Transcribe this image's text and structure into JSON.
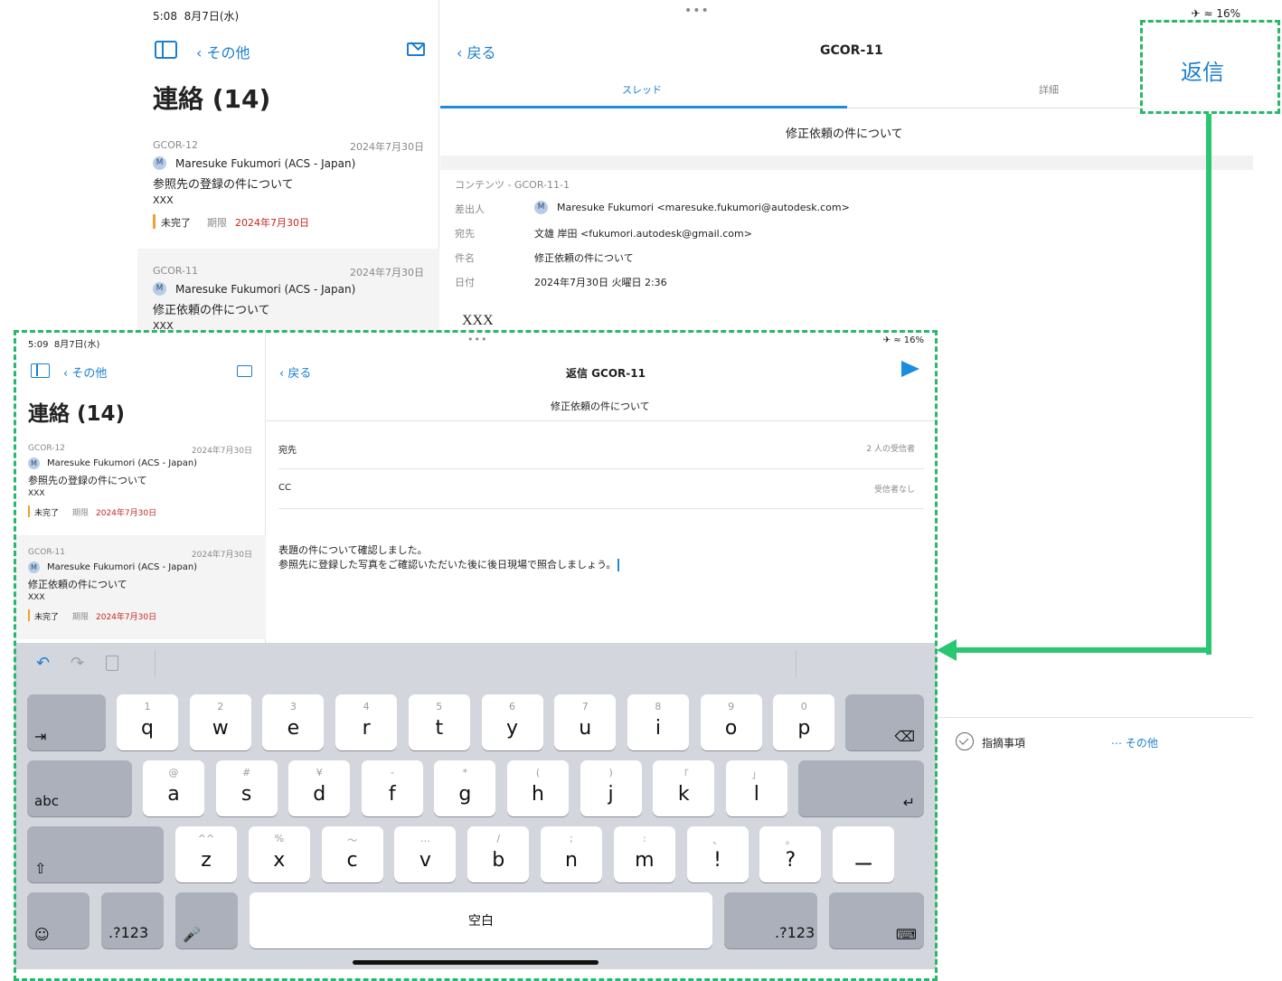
{
  "back": {
    "status_time": "5:08",
    "status_date": "8月7日(水)",
    "status_battery": "16%",
    "nav_back_label": "その他",
    "list_title": "連絡 (14)",
    "items": [
      {
        "id": "GCOR-12",
        "date": "2024年7月30日",
        "avatar": "M",
        "author": "Maresuke Fukumori (ACS - Japan)",
        "subject": "参照先の登録の件について",
        "body": "XXX",
        "status": "未完了",
        "due_label": "期限",
        "due": "2024年7月30日"
      },
      {
        "id": "GCOR-11",
        "date": "2024年7月30日",
        "avatar": "M",
        "author": "Maresuke Fukumori (ACS - Japan)",
        "subject": "修正依頼の件について",
        "body": "XXX"
      }
    ],
    "detail_back": "戻る",
    "detail_title": "GCOR-11",
    "tab_thread": "スレッド",
    "tab_detail": "詳細",
    "reply_label": "返信",
    "thread_subject": "修正依頼の件について",
    "content_label": "コンテンツ - GCOR-11-1",
    "fields": [
      {
        "label": "差出人",
        "value": "Maresuke Fukumori <maresuke.fukumori@autodesk.com>",
        "avatar": "M"
      },
      {
        "label": "宛先",
        "value": "文雄 岸田 <fukumori.autodesk@gmail.com>"
      },
      {
        "label": "件名",
        "value": "修正依頼の件について"
      },
      {
        "label": "日付",
        "value": "2024年7月30日 火曜日 2:36"
      }
    ],
    "body_text": "XXX",
    "bottom_issue": "指摘事項",
    "bottom_more": "その他"
  },
  "front": {
    "status_time": "5:09",
    "status_date": "8月7日(水)",
    "status_battery": "16%",
    "nav_back_label": "その他",
    "list_title": "連絡 (14)",
    "items": [
      {
        "id": "GCOR-12",
        "date": "2024年7月30日",
        "avatar": "M",
        "author": "Maresuke Fukumori (ACS - Japan)",
        "subject": "参照先の登録の件について",
        "body": "XXX",
        "status": "未完了",
        "due_label": "期限",
        "due": "2024年7月30日"
      },
      {
        "id": "GCOR-11",
        "date": "2024年7月30日",
        "avatar": "M",
        "author": "Maresuke Fukumori (ACS - Japan)",
        "subject": "修正依頼の件について",
        "body": "XXX",
        "status": "未完了",
        "due_label": "期限",
        "due": "2024年7月30日"
      }
    ],
    "compose_back": "戻る",
    "compose_title": "返信 GCOR-11",
    "compose_subject": "修正依頼の件について",
    "to_label": "宛先",
    "to_value": "2 人の受信者",
    "cc_label": "CC",
    "cc_value": "受信者なし",
    "message_line1": "表題の件について確認しました。",
    "message_line2": "参照先に登録した写真をご確認いただいた後に後日現場で照合しましょう。"
  },
  "keyboard": {
    "row1": [
      {
        "k": "q",
        "s": "1"
      },
      {
        "k": "w",
        "s": "2"
      },
      {
        "k": "e",
        "s": "3"
      },
      {
        "k": "r",
        "s": "4"
      },
      {
        "k": "t",
        "s": "5"
      },
      {
        "k": "y",
        "s": "6"
      },
      {
        "k": "u",
        "s": "7"
      },
      {
        "k": "i",
        "s": "8"
      },
      {
        "k": "o",
        "s": "9"
      },
      {
        "k": "p",
        "s": "0"
      }
    ],
    "row2": [
      {
        "k": "a",
        "s": "@"
      },
      {
        "k": "s",
        "s": "#"
      },
      {
        "k": "d",
        "s": "¥"
      },
      {
        "k": "f",
        "s": "-"
      },
      {
        "k": "g",
        "s": "*"
      },
      {
        "k": "h",
        "s": "("
      },
      {
        "k": "j",
        "s": ")"
      },
      {
        "k": "k",
        "s": "「"
      },
      {
        "k": "l",
        "s": "」"
      }
    ],
    "row3": [
      {
        "k": "z",
        "s": "^^"
      },
      {
        "k": "x",
        "s": "%"
      },
      {
        "k": "c",
        "s": "〜"
      },
      {
        "k": "v",
        "s": "…"
      },
      {
        "k": "b",
        "s": "/"
      },
      {
        "k": "n",
        "s": ";"
      },
      {
        "k": "m",
        "s": ":"
      },
      {
        "k": "!",
        "s": "、"
      },
      {
        "k": "?",
        "s": "。"
      },
      {
        "k": "ー",
        "s": ""
      }
    ],
    "abc": "abc",
    "num": ".?123",
    "space": "空白"
  }
}
